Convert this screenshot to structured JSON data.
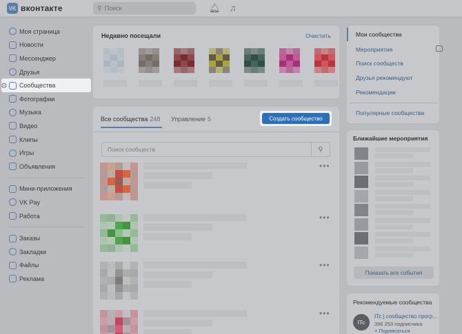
{
  "header": {
    "logo_text": "вконтакте",
    "logo_mark": "VK",
    "search_placeholder": "Поиск",
    "icons": [
      "bell-icon",
      "music-icon"
    ]
  },
  "sidebar": {
    "items": [
      {
        "label": "Моя страница",
        "icon": "user-icon"
      },
      {
        "label": "Новости",
        "icon": "news-icon"
      },
      {
        "label": "Мессенджер",
        "icon": "chat-icon"
      },
      {
        "label": "Друзья",
        "icon": "friends-icon"
      },
      {
        "label": "Сообщества",
        "icon": "communities-icon",
        "active": true
      },
      {
        "label": "Фотографии",
        "icon": "photo-icon"
      },
      {
        "label": "Музыка",
        "icon": "music-icon"
      },
      {
        "label": "Видео",
        "icon": "video-icon"
      },
      {
        "label": "Клипы",
        "icon": "clips-icon"
      },
      {
        "label": "Игры",
        "icon": "games-icon"
      },
      {
        "label": "Объявления",
        "icon": "ads-icon"
      },
      {
        "label": "Мини-приложения",
        "icon": "apps-icon"
      },
      {
        "label": "VK Pay",
        "icon": "vkpay-icon"
      },
      {
        "label": "Работа",
        "icon": "work-icon"
      },
      {
        "label": "Заказы",
        "icon": "orders-icon"
      },
      {
        "label": "Закладки",
        "icon": "bookmarks-icon"
      },
      {
        "label": "Файлы",
        "icon": "files-icon"
      },
      {
        "label": "Реклама",
        "icon": "advert-icon"
      }
    ]
  },
  "recent": {
    "title": "Недавно посещали",
    "clear_label": "Очистить"
  },
  "communities": {
    "tab_all_label": "Все сообщества",
    "tab_all_count": "248",
    "tab_manage_label": "Управление",
    "tab_manage_count": "5",
    "create_button": "Создать сообщество",
    "search_placeholder": "Поиск сообществ",
    "more_glyph": "•••"
  },
  "right_menu": {
    "items": [
      "Мои сообщества",
      "Мероприятия",
      "Поиск сообществ",
      "Друзья рекомендуют",
      "Рекомендации",
      "Популярные сообщества"
    ]
  },
  "events": {
    "title": "Ближайшие мероприятия",
    "show_all": "Показать все события"
  },
  "recommended": {
    "title": "Рекомендуемые сообщества",
    "avatar_text": "ITc",
    "name": "ITc | сообщество прогр...",
    "subscribers": "396 253 подписчика",
    "subscribe": "+ Подписаться"
  },
  "colors": {
    "accent": "#2d6fb6",
    "link": "#3d5f85",
    "overlay_bg": "#b9bbbe"
  }
}
